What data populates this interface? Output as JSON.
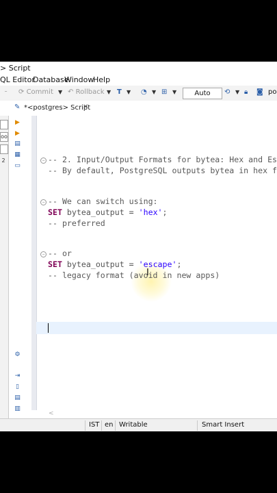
{
  "window": {
    "title": "> Script"
  },
  "menu": {
    "items": [
      "QL Editor",
      "Database",
      "Window",
      "Help"
    ]
  },
  "toolbar": {
    "commit_label": "Commit",
    "rollback_label": "Rollback",
    "transaction_mode": "Auto",
    "cut_label": "po"
  },
  "tab": {
    "label": "*<postgres> Script",
    "close": "✕"
  },
  "left_strip": {
    "labels": [
      "",
      "oo",
      "",
      "2"
    ]
  },
  "editor": {
    "lines": [
      {
        "fold": true,
        "parts": [
          [
            "cmt",
            "-- 2. Input/Output Formats for bytea: Hex and Esc"
          ]
        ]
      },
      {
        "fold": false,
        "parts": [
          [
            "cmt",
            "-- By default, PostgreSQL outputs bytea in hex fo"
          ]
        ]
      },
      {
        "fold": true,
        "parts": [
          [
            "cmt",
            "-- We can switch using:"
          ]
        ]
      },
      {
        "fold": false,
        "parts": [
          [
            "kw",
            "SET"
          ],
          [
            "txt",
            " bytea_output = "
          ],
          [
            "str",
            "'hex'"
          ],
          [
            "txt",
            ";"
          ]
        ]
      },
      {
        "fold": false,
        "parts": [
          [
            "cmt",
            "-- preferred"
          ]
        ]
      },
      {
        "fold": true,
        "parts": [
          [
            "cmt",
            "-- or"
          ]
        ]
      },
      {
        "fold": false,
        "parts": [
          [
            "kw",
            "SET"
          ],
          [
            "txt",
            " bytea_output = "
          ],
          [
            "str",
            "'escape'"
          ],
          [
            "txt",
            ";"
          ]
        ]
      },
      {
        "fold": false,
        "parts": [
          [
            "cmt",
            "-- legacy format (avoid in new apps)"
          ]
        ]
      }
    ]
  },
  "status": {
    "timezone": "IST",
    "locale": "en",
    "mode": "Writable",
    "insert": "Smart Insert"
  },
  "colors": {
    "keyword": "#7f0055",
    "string": "#2a00ff",
    "comment": "#595959",
    "current_line": "#e8f2fe"
  },
  "icons": [
    "run-statement-icon",
    "run-script-icon",
    "explain-icon",
    "format-icon",
    "console-icon",
    "settings-icon",
    "export-icon",
    "file-lock-icon",
    "sql-file-icon",
    "panels-icon"
  ]
}
